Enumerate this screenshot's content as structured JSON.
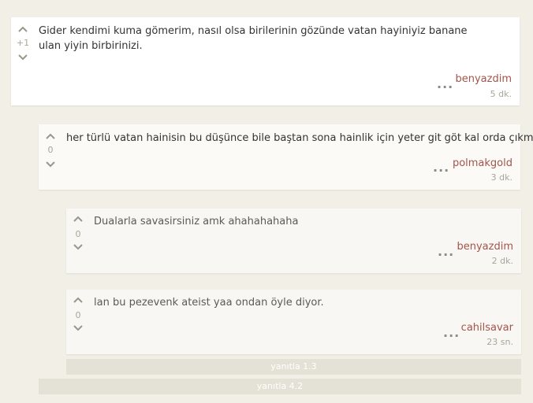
{
  "colors": {
    "background": "#f1efe6",
    "author": "#a4544a",
    "muted": "#a9a59a",
    "reply_bar": "#e4e1d6"
  },
  "comments": [
    {
      "votes": "+1",
      "text": "Gider kendimi kuma gömerim, nasıl olsa birilerinin gözünde vatan hayiniyiz banane ulan yiyin birbirinizi.",
      "more": "...",
      "author": "benyazdim",
      "time": "5 dk."
    },
    {
      "votes": "0",
      "text": "her türlü vatan hainisin bu düşünce bile baştan sona hainlik için yeter git göt kal orda çıkma",
      "more": "...",
      "author": "polmakgold",
      "time": "3 dk."
    },
    {
      "votes": "0",
      "text": "Dualarla savasirsiniz amk ahahahahaha",
      "more": "...",
      "author": "benyazdim",
      "time": "2 dk."
    },
    {
      "votes": "0",
      "text": "lan bu pezevenk ateist yaa ondan öyle diyor.",
      "more": "...",
      "author": "cahilsavar",
      "time": "23 sn."
    }
  ],
  "reply_buttons": [
    {
      "label": "yanıtla 1.3"
    },
    {
      "label": "yanıtla 4.2"
    }
  ],
  "icons": {
    "upvote": "chevron-up-icon",
    "downvote": "chevron-down-icon"
  }
}
